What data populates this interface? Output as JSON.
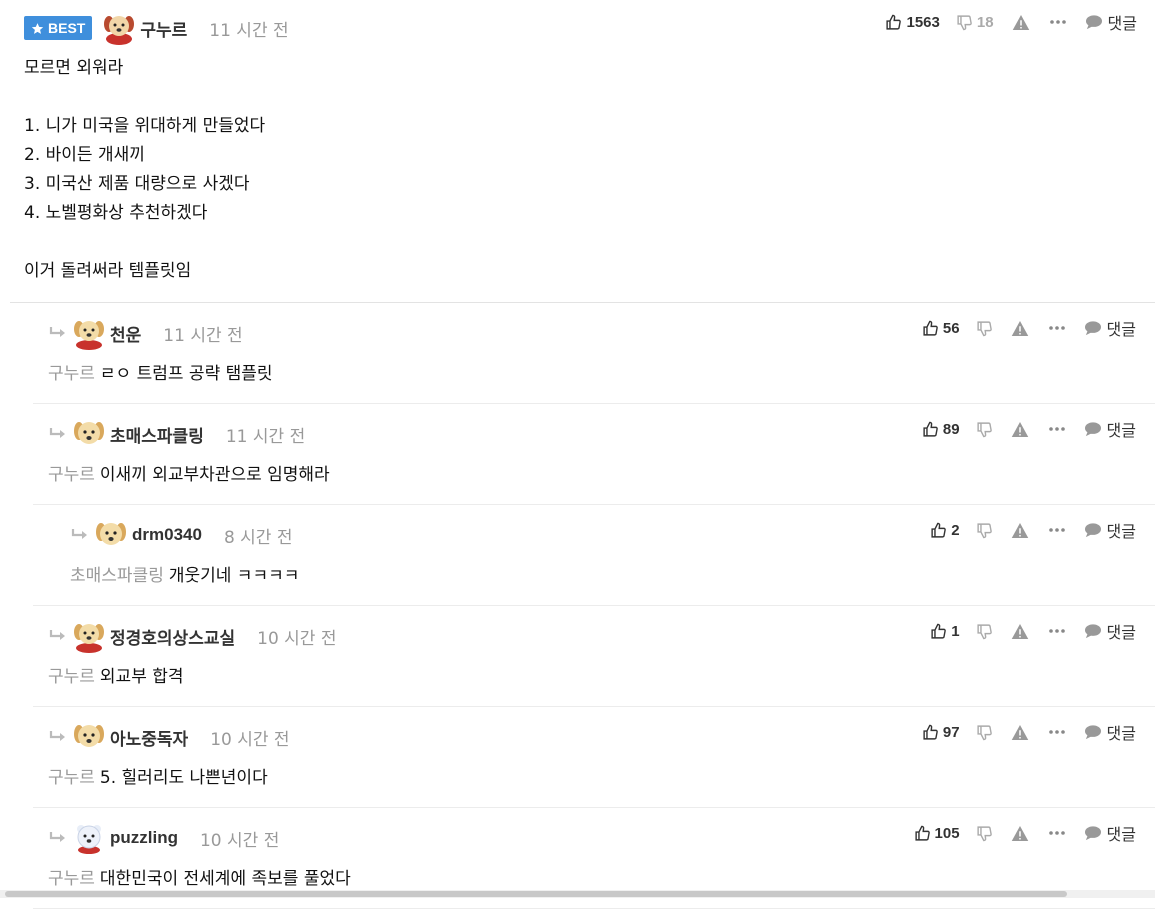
{
  "best": {
    "badge": "BEST",
    "nick": "구누르",
    "time": "11 시간 전",
    "likes": "1563",
    "dislikes": "18",
    "reply_label": "댓글",
    "body": "모르면 외워라\n\n1. 니가 미국을 위대하게 만들었다\n2. 바이든 개새끼\n3. 미국산 제품 대량으로 사겠다\n4. 노벨평화상 추천하겠다\n\n이거 돌려써라 템플릿임"
  },
  "replies": [
    {
      "nick": "천운",
      "time": "11 시간 전",
      "mention": "구누르",
      "text": "ㄹㅇ 트럼프 공략 탬플릿",
      "likes": "56",
      "avatar": "dog-red"
    },
    {
      "nick": "초매스파클링",
      "time": "11 시간 전",
      "mention": "구누르",
      "text": "이새끼 외교부차관으로 임명해라",
      "likes": "89",
      "avatar": "dog"
    },
    {
      "nick": "drm0340",
      "time": "8 시간 전",
      "mention": "초매스파클링",
      "text": "개웃기네 ㅋㅋㅋㅋ",
      "likes": "2",
      "avatar": "dog"
    },
    {
      "nick": "정경호의상스교실",
      "time": "10 시간 전",
      "mention": "구누르",
      "text": "외교부 합격",
      "likes": "1",
      "avatar": "dog-red"
    },
    {
      "nick": "아노중독자",
      "time": "10 시간 전",
      "mention": "구누르",
      "text": "5. 힐러리도 나쁜년이다",
      "likes": "97",
      "avatar": "dog"
    },
    {
      "nick": "puzzling",
      "time": "10 시간 전",
      "mention": "구누르",
      "text": "대한민국이 전세계에 족보를 풀었다",
      "likes": "105",
      "avatar": "bear"
    }
  ],
  "reply_label": "댓글",
  "colors": {
    "badge": "#3f8fdc",
    "muted": "#999999"
  }
}
